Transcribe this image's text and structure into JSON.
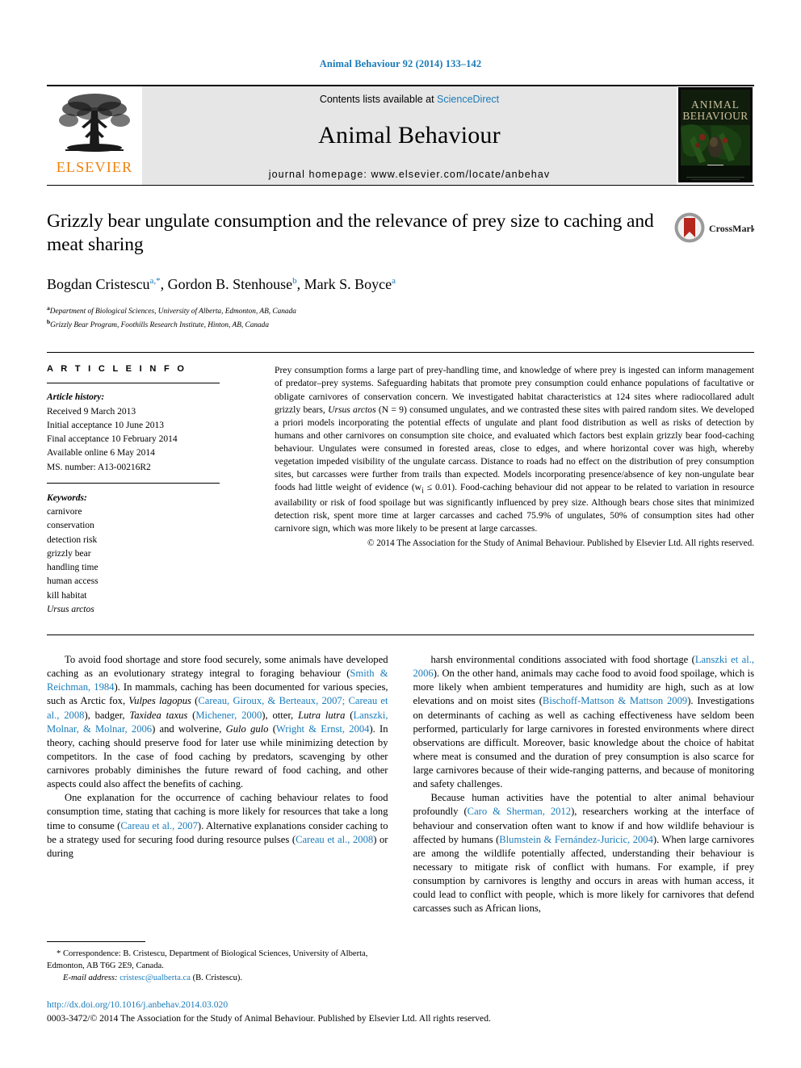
{
  "running_head": "Animal Behaviour 92 (2014) 133–142",
  "masthead": {
    "contents_prefix": "Contents lists available at ",
    "sciencedirect": "ScienceDirect",
    "journal_name": "Animal Behaviour",
    "homepage": "journal homepage: www.elsevier.com/locate/anbehav",
    "publisher_wordmark": "ELSEVIER",
    "cover_title_line1": "ANIMAL",
    "cover_title_line2": "BEHAVIOUR",
    "logo_icon": "elsevier-tree-icon",
    "cover_icon": "journal-cover-thumbnail"
  },
  "article": {
    "title": "Grizzly bear ungulate consumption and the relevance of prey size to caching and meat sharing",
    "crossmark_label": "CrossMark",
    "authors": [
      {
        "name": "Bogdan Cristescu",
        "marks": "a,*"
      },
      {
        "name": "Gordon B. Stenhouse",
        "marks": "b"
      },
      {
        "name": "Mark S. Boyce",
        "marks": "a"
      }
    ],
    "affiliations": [
      {
        "mark": "a",
        "text": "Department of Biological Sciences, University of Alberta, Edmonton, AB, Canada"
      },
      {
        "mark": "b",
        "text": "Grizzly Bear Program, Foothills Research Institute, Hinton, AB, Canada"
      }
    ]
  },
  "article_info": {
    "heading": "A R T I C L E   I N F O",
    "history_label": "Article history:",
    "history": [
      "Received 9 March 2013",
      "Initial acceptance 10 June 2013",
      "Final acceptance 10 February 2014",
      "Available online 6 May 2014",
      "MS. number: A13-00216R2"
    ],
    "keywords_label": "Keywords:",
    "keywords": [
      {
        "text": "carnivore",
        "italic": false
      },
      {
        "text": "conservation",
        "italic": false
      },
      {
        "text": "detection risk",
        "italic": false
      },
      {
        "text": "grizzly bear",
        "italic": false
      },
      {
        "text": "handling time",
        "italic": false
      },
      {
        "text": "human access",
        "italic": false
      },
      {
        "text": "kill habitat",
        "italic": false
      },
      {
        "text": "Ursus arctos",
        "italic": true
      }
    ]
  },
  "abstract": {
    "part1": "Prey consumption forms a large part of prey-handling time, and knowledge of where prey is ingested can inform management of predator–prey systems. Safeguarding habitats that promote prey consumption could enhance populations of facultative or obligate carnivores of conservation concern. We investigated habitat characteristics at 124 sites where radiocollared adult grizzly bears, ",
    "species": "Ursus arctos",
    "part2": " (N = 9) consumed ungulates, and we contrasted these sites with paired random sites. We developed a priori models incorporating the potential effects of ungulate and plant food distribution as well as risks of detection by humans and other carnivores on consumption site choice, and evaluated which factors best explain grizzly bear food-caching behaviour. Ungulates were consumed in forested areas, close to edges, and where horizontal cover was high, whereby vegetation impeded visibility of the ungulate carcass. Distance to roads had no effect on the distribution of prey consumption sites, but carcasses were further from trails than expected. Models incorporating presence/absence of key non-ungulate bear foods had little weight of evidence (w",
    "sub1": "i",
    "part3": " ≤ 0.01). Food-caching behaviour did not appear to be related to variation in resource availability or risk of food spoilage but was significantly influenced by prey size. Although bears chose sites that minimized detection risk, spent more time at larger carcasses and cached 75.9% of ungulates, 50% of consumption sites had other carnivore sign, which was more likely to be present at large carcasses.",
    "copyright": "© 2014 The Association for the Study of Animal Behaviour. Published by Elsevier Ltd. All rights reserved."
  },
  "body": {
    "left_column": [
      {
        "segments": [
          {
            "t": "To avoid food shortage and store food securely, some animals have developed caching as an evolutionary strategy integral to foraging behaviour (",
            "s": "plain"
          },
          {
            "t": "Smith & Reichman, 1984",
            "s": "ref"
          },
          {
            "t": "). In mammals, caching has been documented for various species, such as Arctic fox, ",
            "s": "plain"
          },
          {
            "t": "Vulpes lagopus",
            "s": "italic"
          },
          {
            "t": " (",
            "s": "plain"
          },
          {
            "t": "Careau, Giroux, & Berteaux, 2007; Careau et al., 2008",
            "s": "ref"
          },
          {
            "t": "), badger, ",
            "s": "plain"
          },
          {
            "t": "Taxidea taxus",
            "s": "italic"
          },
          {
            "t": " (",
            "s": "plain"
          },
          {
            "t": "Michener, 2000",
            "s": "ref"
          },
          {
            "t": "), otter, ",
            "s": "plain"
          },
          {
            "t": "Lutra lutra",
            "s": "italic"
          },
          {
            "t": " (",
            "s": "plain"
          },
          {
            "t": "Lanszki, Molnar, & Molnar, 2006",
            "s": "ref"
          },
          {
            "t": ") and wolverine, ",
            "s": "plain"
          },
          {
            "t": "Gulo gulo",
            "s": "italic"
          },
          {
            "t": " (",
            "s": "plain"
          },
          {
            "t": "Wright & Ernst, 2004",
            "s": "ref"
          },
          {
            "t": "). In theory, caching should preserve food for later use while minimizing detection by competitors. In the case of food caching by predators, scavenging by other carnivores probably diminishes the future reward of food caching, and other aspects could also affect the benefits of caching.",
            "s": "plain"
          }
        ]
      },
      {
        "segments": [
          {
            "t": "One explanation for the occurrence of caching behaviour relates to food consumption time, stating that caching is more likely for resources that take a long time to consume (",
            "s": "plain"
          },
          {
            "t": "Careau et al., 2007",
            "s": "ref"
          },
          {
            "t": "). Alternative explanations consider caching to be a strategy used for securing food during resource pulses (",
            "s": "plain"
          },
          {
            "t": "Careau et al., 2008",
            "s": "ref"
          },
          {
            "t": ") or during",
            "s": "plain"
          }
        ]
      }
    ],
    "right_column": [
      {
        "segments": [
          {
            "t": "harsh environmental conditions associated with food shortage (",
            "s": "plain"
          },
          {
            "t": "Lanszki et al., 2006",
            "s": "ref"
          },
          {
            "t": "). On the other hand, animals may cache food to avoid food spoilage, which is more likely when ambient temperatures and humidity are high, such as at low elevations and on moist sites (",
            "s": "plain"
          },
          {
            "t": "Bischoff-Mattson & Mattson 2009",
            "s": "ref"
          },
          {
            "t": "). Investigations on determinants of caching as well as caching effectiveness have seldom been performed, particularly for large carnivores in forested environments where direct observations are difficult. Moreover, basic knowledge about the choice of habitat where meat is consumed and the duration of prey consumption is also scarce for large carnivores because of their wide-ranging patterns, and because of monitoring and safety challenges.",
            "s": "plain"
          }
        ]
      },
      {
        "segments": [
          {
            "t": "Because human activities have the potential to alter animal behaviour profoundly (",
            "s": "plain"
          },
          {
            "t": "Caro & Sherman, 2012",
            "s": "ref"
          },
          {
            "t": "), researchers working at the interface of behaviour and conservation often want to know if and how wildlife behaviour is affected by humans (",
            "s": "plain"
          },
          {
            "t": "Blumstein & Fernández-Juricic, 2004",
            "s": "ref"
          },
          {
            "t": "). When large carnivores are among the wildlife potentially affected, understanding their behaviour is necessary to mitigate risk of conflict with humans. For example, if prey consumption by carnivores is lengthy and occurs in areas with human access, it could lead to conflict with people, which is more likely for carnivores that defend carcasses such as African lions,",
            "s": "plain"
          }
        ]
      }
    ]
  },
  "footnote": {
    "correspondence": "* Correspondence: B. Cristescu, Department of Biological Sciences, University of Alberta, Edmonton, AB T6G 2E9, Canada.",
    "email_label": "E-mail address: ",
    "email": "cristesc@ualberta.ca",
    "email_suffix": " (B. Cristescu)."
  },
  "footer": {
    "doi": "http://dx.doi.org/10.1016/j.anbehav.2014.03.020",
    "issn_line": "0003-3472/© 2014 The Association for the Study of Animal Behaviour. Published by Elsevier Ltd. All rights reserved."
  },
  "colors": {
    "link": "#1a7bb9",
    "elsevier_orange": "#f07f09",
    "masthead_grey": "#e6e6e6",
    "crossmark_red": "#b5261e"
  }
}
